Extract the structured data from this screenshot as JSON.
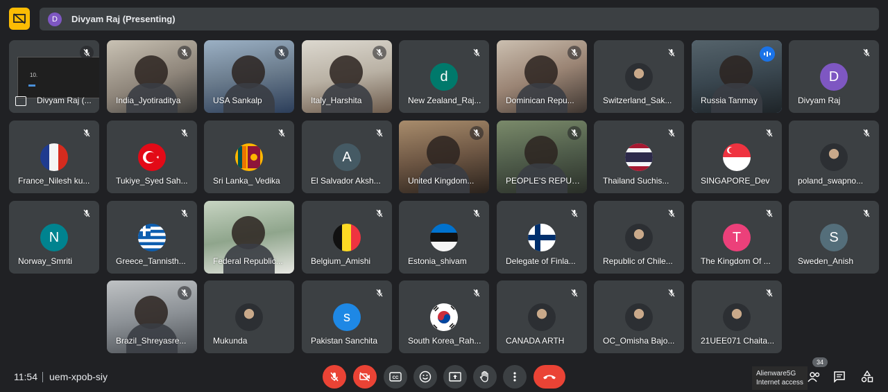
{
  "presenting": {
    "initial": "D",
    "avatar_color": "#7e57c2",
    "text": "Divyam Raj (Presenting)"
  },
  "tiles": [
    {
      "name": "Divyam Raj (...",
      "kind": "screen",
      "muted": true
    },
    {
      "name": "India_Jyotiraditya",
      "kind": "video",
      "muted": true
    },
    {
      "name": "USA Sankalp",
      "kind": "video",
      "muted": true
    },
    {
      "name": "Italy_Harshita",
      "kind": "video",
      "muted": true
    },
    {
      "name": "New Zealand_Raj...",
      "kind": "letter",
      "letter": "d",
      "color": "#00796b",
      "muted": true
    },
    {
      "name": "Dominican Repu...",
      "kind": "video",
      "muted": true
    },
    {
      "name": "Switzerland_Sak...",
      "kind": "picture",
      "muted": true
    },
    {
      "name": "Russia Tanmay",
      "kind": "video",
      "muted": false,
      "speaking": true
    },
    {
      "name": "Divyam Raj",
      "kind": "letter",
      "letter": "D",
      "color": "#7e57c2",
      "muted": true
    },
    {
      "name": "France_Nilesh ku...",
      "kind": "flag",
      "flag": "france",
      "muted": true
    },
    {
      "name": "Tukiye_Syed Sah...",
      "kind": "flag",
      "flag": "turkey",
      "muted": true
    },
    {
      "name": "Sri Lanka_ Vedika",
      "kind": "flag",
      "flag": "srilanka",
      "muted": true
    },
    {
      "name": "El Salvador Aksh...",
      "kind": "letter",
      "letter": "A",
      "color": "#455a64",
      "muted": true
    },
    {
      "name": "United Kingdom...",
      "kind": "video",
      "muted": true
    },
    {
      "name": "PEOPLE'S REPUB...",
      "kind": "video",
      "muted": true
    },
    {
      "name": "Thailand Suchis...",
      "kind": "flag",
      "flag": "thailand",
      "muted": true
    },
    {
      "name": "SINGAPORE_Dev",
      "kind": "flag",
      "flag": "singapore",
      "muted": true
    },
    {
      "name": "poland_swapno...",
      "kind": "picture",
      "muted": true
    },
    {
      "name": "Norway_Smriti",
      "kind": "letter",
      "letter": "N",
      "color": "#00838f",
      "muted": true
    },
    {
      "name": "Greece_Tannisth...",
      "kind": "flag",
      "flag": "greece",
      "muted": true
    },
    {
      "name": "Federal Republic...",
      "kind": "video",
      "muted": false
    },
    {
      "name": "Belgium_Amishi",
      "kind": "flag",
      "flag": "belgium",
      "muted": true
    },
    {
      "name": "Estonia_shivam",
      "kind": "flag",
      "flag": "estonia",
      "muted": true
    },
    {
      "name": "Delegate of Finla...",
      "kind": "flag",
      "flag": "finland",
      "muted": true
    },
    {
      "name": "Republic of Chile...",
      "kind": "picture",
      "muted": true
    },
    {
      "name": "The Kingdom Of ...",
      "kind": "letter",
      "letter": "T",
      "color": "#ec407a",
      "muted": true
    },
    {
      "name": "Sweden_Anish",
      "kind": "letter",
      "letter": "S",
      "color": "#546e7a",
      "muted": true
    },
    {
      "name": "Brazil_Shreyasre...",
      "kind": "video",
      "muted": true
    },
    {
      "name": "Mukunda",
      "kind": "picture",
      "muted": false
    },
    {
      "name": "Pakistan Sanchita",
      "kind": "letter",
      "letter": "s",
      "color": "#1e88e5",
      "muted": true
    },
    {
      "name": "South Korea_Rah...",
      "kind": "flag",
      "flag": "korea",
      "muted": true
    },
    {
      "name": "CANADA ARTH",
      "kind": "picture",
      "muted": true
    },
    {
      "name": "OC_Omisha Bajo...",
      "kind": "picture",
      "muted": true
    },
    {
      "name": "21UEE071 Chaita...",
      "kind": "picture",
      "muted": true
    }
  ],
  "bottom": {
    "time": "11:54",
    "meeting_code": "uem-xpob-siy",
    "tooltip_line1": "Alienware5G",
    "tooltip_line2": "Internet access",
    "participant_count": "34",
    "icons": [
      "mic-off-icon",
      "camera-off-icon",
      "captions-icon",
      "emoji-icon",
      "present-screen-icon",
      "raise-hand-icon",
      "more-options-icon",
      "end-call-icon"
    ]
  }
}
